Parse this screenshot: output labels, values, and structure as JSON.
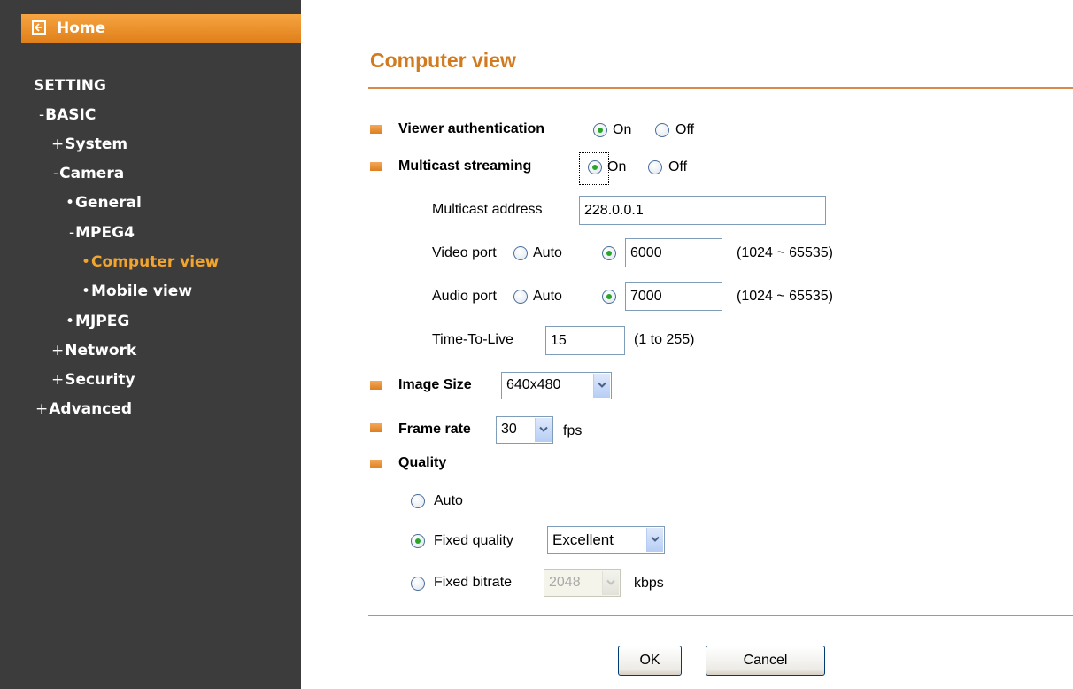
{
  "sidebar": {
    "home": "Home",
    "setting": "SETTING",
    "items": [
      {
        "prefix": "-",
        "label": "BASIC"
      },
      {
        "prefix": "+",
        "label": "System"
      },
      {
        "prefix": "-",
        "label": "Camera"
      },
      {
        "prefix": "•",
        "label": "General"
      },
      {
        "prefix": "-",
        "label": "MPEG4"
      },
      {
        "prefix": "•",
        "label": "Computer view"
      },
      {
        "prefix": "•",
        "label": "Mobile view"
      },
      {
        "prefix": "•",
        "label": "MJPEG"
      },
      {
        "prefix": "+",
        "label": "Network"
      },
      {
        "prefix": "+",
        "label": "Security"
      },
      {
        "prefix": "+",
        "label": "Advanced"
      }
    ],
    "active_item": "Computer view"
  },
  "main": {
    "title": "Computer view",
    "viewer_auth": {
      "label": "Viewer authentication",
      "on": "On",
      "off": "Off",
      "selected": "On"
    },
    "multicast": {
      "label": "Multicast streaming",
      "on": "On",
      "off": "Off",
      "selected": "On",
      "address_label": "Multicast address",
      "address_value": "228.0.0.1",
      "video_port_label": "Video port",
      "video_auto": "Auto",
      "video_port_value": "6000",
      "video_range": "(1024 ~ 65535)",
      "audio_port_label": "Audio port",
      "audio_auto": "Auto",
      "audio_port_value": "7000",
      "audio_range": "(1024 ~ 65535)",
      "ttl_label": "Time-To-Live",
      "ttl_value": "15",
      "ttl_range": "(1 to 255)"
    },
    "image_size": {
      "label": "Image Size",
      "value": "640x480"
    },
    "frame_rate": {
      "label": "Frame rate",
      "value": "30",
      "unit": "fps"
    },
    "quality": {
      "label": "Quality",
      "auto": "Auto",
      "fixed_quality": "Fixed quality",
      "fixed_quality_value": "Excellent",
      "fixed_bitrate": "Fixed bitrate",
      "fixed_bitrate_value": "2048",
      "bitrate_unit": "kbps",
      "selected": "Fixed quality"
    },
    "ok": "OK",
    "cancel": "Cancel"
  },
  "colors": {
    "accent": "#d27a1f",
    "sidebar_bg": "#3c3c3c",
    "home_bar": "#ee9430",
    "active_nav": "#f2a52e"
  }
}
